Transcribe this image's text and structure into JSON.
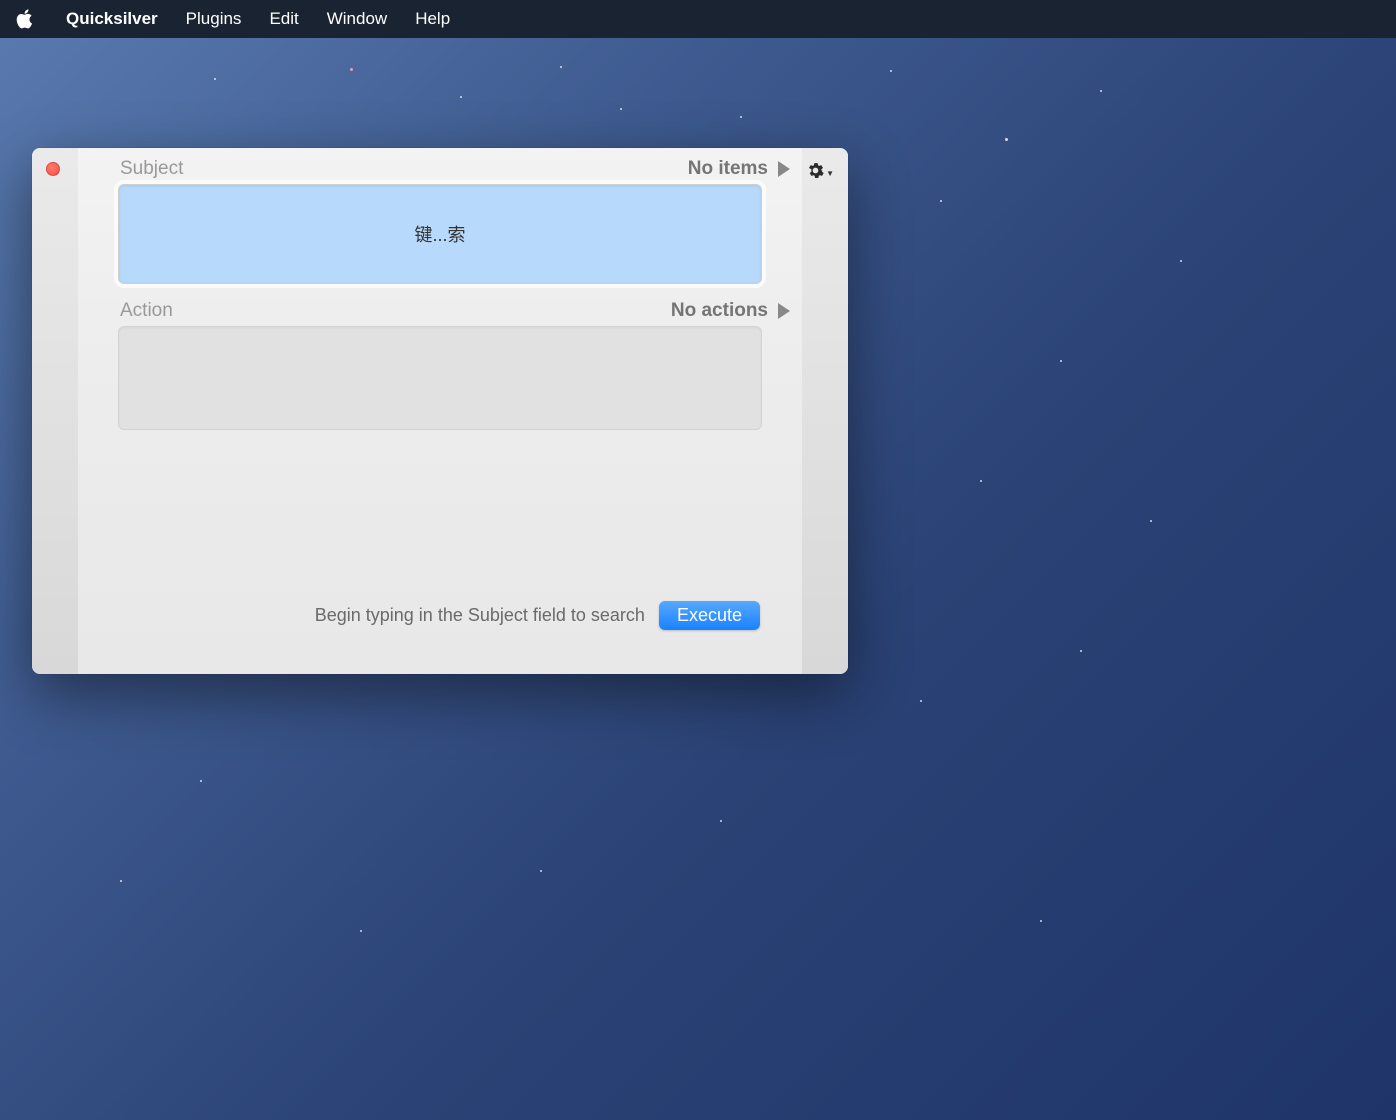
{
  "menubar": {
    "app": "Quicksilver",
    "items": [
      "Plugins",
      "Edit",
      "Window",
      "Help"
    ]
  },
  "window": {
    "subject": {
      "label": "Subject",
      "status": "No items",
      "field_text": "键...索"
    },
    "action": {
      "label": "Action",
      "status": "No actions"
    },
    "footer": {
      "hint": "Begin typing in the Subject field to search",
      "button": "Execute"
    }
  }
}
